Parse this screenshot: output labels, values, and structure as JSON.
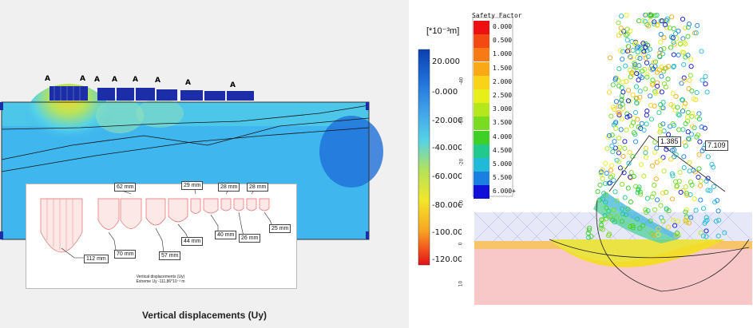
{
  "left": {
    "caption": "Vertical displacements (Uy)",
    "inset": {
      "title": "Vertical displacements (Uy)",
      "extreme": "Extreme Uy -111,86*10⁻³ m",
      "values": [
        "112 mm",
        "70 mm",
        "57 mm",
        "44 mm",
        "40 mm",
        "26 mm",
        "25 mm",
        "62 mm",
        "29 mm",
        "28 mm",
        "28 mm"
      ]
    },
    "load_marker": "A"
  },
  "scale": {
    "unit": "[*10⁻³m]",
    "ticks": [
      "20.000",
      "-0.000",
      "-20.000",
      "-40.000",
      "-60.000",
      "-80.000",
      "-100.000",
      "-120.000"
    ],
    "colors": [
      "#0b3fb0",
      "#1f6fd8",
      "#3fa0ea",
      "#55d2e8",
      "#b4e25a",
      "#f2e62a",
      "#f7a623",
      "#f25a1c",
      "#e0111a"
    ]
  },
  "right": {
    "legend_title": "Safety Factor",
    "legend_entries": [
      "0.000",
      "0.500",
      "1.000",
      "1.500",
      "2.000",
      "2.500",
      "3.000",
      "3.500",
      "4.000",
      "4.500",
      "5.000",
      "5.500",
      "6.000+"
    ],
    "legend_colors": [
      "#ee1010",
      "#f24a12",
      "#f77a14",
      "#f9a816",
      "#f8d318",
      "#e7ee1a",
      "#b5e81c",
      "#79dc20",
      "#3fd027",
      "#22c98d",
      "#20b9d7",
      "#1a7fe0",
      "#1010d8"
    ],
    "fs_labels": [
      "1.385",
      "7.109"
    ],
    "axis_ticks": [
      "10",
      "0",
      "-10",
      "-20",
      "-30",
      "-40"
    ]
  }
}
